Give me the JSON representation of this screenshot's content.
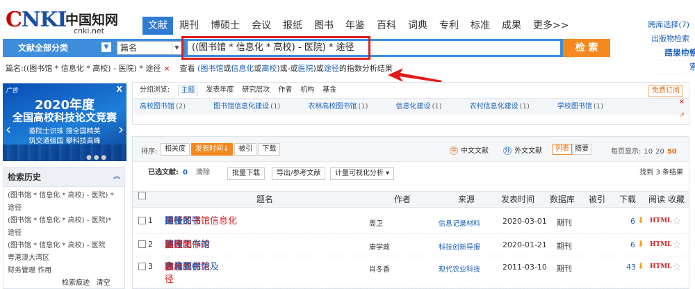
{
  "logo": {
    "brand": "CNKI",
    "chinese": "中国知网",
    "url": "cnki.net"
  },
  "nav": {
    "items": [
      "文献",
      "期刊",
      "博硕士",
      "会议",
      "报纸",
      "图书",
      "年鉴",
      "百科",
      "词典",
      "专利",
      "标准",
      "成果",
      "更多>>"
    ],
    "active": 0
  },
  "right_links": {
    "cross": "跨库选择(7)",
    "pub": "出版物检索",
    "in_result": "结果中检索",
    "advanced": "高级检索"
  },
  "search": {
    "scope": "文献全部分类",
    "field": "篇名",
    "query": "((图书馆 * 信息化 * 高校) - 医院) * 途径",
    "button": "检 索"
  },
  "tip": {
    "current": "篇名:((图书馆 * 信息化 * 高校) - 医院) * 途径",
    "close": "×",
    "p1": "查看",
    "p2": "(图书馆",
    "p3": "或",
    "p4": "信息化",
    "p5": "或",
    "p6": "高校",
    "p7": ")或-或",
    "p8": "医院",
    "p9": ")或",
    "p10": "途径",
    "p11": "的指数分析结果"
  },
  "ad": {
    "tag": "广告",
    "close": "X",
    "year": "2020年度",
    "title": "全国高校科技论文竞赛",
    "line1": "邀院士识珠 搜全国精英",
    "line2": "筑交通强国 攀科技高峰",
    "dots": "● ● ●"
  },
  "history": {
    "title": "检索历史",
    "items": [
      "(图书馆 * 信息化 * 高校) - 医院) * 途径",
      "(图书馆 * 信息化 * 高校) - 医院)* 途径",
      "(图书馆 * 信息化 * 高校) - 医院",
      "粤港澳大湾区",
      "财务管理 作用"
    ],
    "trace": "检索痕迹",
    "clear": "清空"
  },
  "group": {
    "label": "分组浏览:",
    "tabs": [
      "主题",
      "发表年度",
      "研究层次",
      "作者",
      "机构",
      "基金"
    ],
    "active_tab": 0,
    "free_sub": "免费订阅",
    "items": [
      {
        "name": "高校图书馆",
        "count": "(2)"
      },
      {
        "name": "图书馆信息化建设",
        "count": "(1)"
      },
      {
        "name": "农林高校图书馆",
        "count": "(1)"
      },
      {
        "name": "信息化建设",
        "count": "(1)"
      },
      {
        "name": "农村信息化建设",
        "count": "(1)"
      },
      {
        "name": "学校图书馆",
        "count": "(1)"
      }
    ],
    "close": "×",
    "chart_icon": "⇗"
  },
  "sort": {
    "label": "排序:",
    "options": [
      "相关度",
      "发表时间↓",
      "被引",
      "下载"
    ],
    "active": 1,
    "chinese": "中文文献",
    "foreign": "外文文献",
    "views": [
      "列表",
      "摘要"
    ],
    "active_view": 0,
    "per_page_label": "每页显示:",
    "per_page": [
      "10",
      "20",
      "50"
    ],
    "per_page_selected": 2
  },
  "selection": {
    "label": "已选文献:",
    "count": "0",
    "clear": "清除",
    "batch": "批量下载",
    "export": "导出/参考文献",
    "viz": "计量可视化分析 ▾",
    "found": "找到 3 条结果"
  },
  "table": {
    "headers": {
      "title": "题名",
      "author": "作者",
      "source": "来源",
      "date": "发表时间",
      "db": "数据库",
      "cited": "被引",
      "download": "下载",
      "read": "阅读",
      "fav": "收藏"
    },
    "rows": [
      {
        "num": "1",
        "title_parts": [
          "关于加强",
          "高校图书馆信息化",
          "建设的",
          "途径",
          "探析"
        ],
        "author": "周卫",
        "source": "信息记录材料",
        "date": "2020-03-01",
        "db": "期刊",
        "download": "6",
        "read": "HTML"
      },
      {
        "num": "2",
        "title_parts": [
          "",
          "高校图书馆",
          "管理工作的",
          "信息化",
          "建设",
          "途径",
          ""
        ],
        "author": "康学政",
        "source": "科技创新导报",
        "date": "2020-01-21",
        "db": "期刊",
        "download": "6",
        "read": "HTML"
      },
      {
        "num": "3",
        "title_parts": [
          "农林",
          "高校图书馆",
          "参与农村",
          "信息化",
          "建设的优势及",
          "途",
          ""
        ],
        "title_line2": "径",
        "author": "肖冬香",
        "source": "现代农业科技",
        "date": "2011-03-10",
        "db": "期刊",
        "download": "43",
        "read": "HTML"
      }
    ]
  },
  "colors": {
    "primary": "#2f7bd2",
    "accent": "#f3891f",
    "highlight": "#d62020",
    "annotation": "#e01b1b"
  }
}
